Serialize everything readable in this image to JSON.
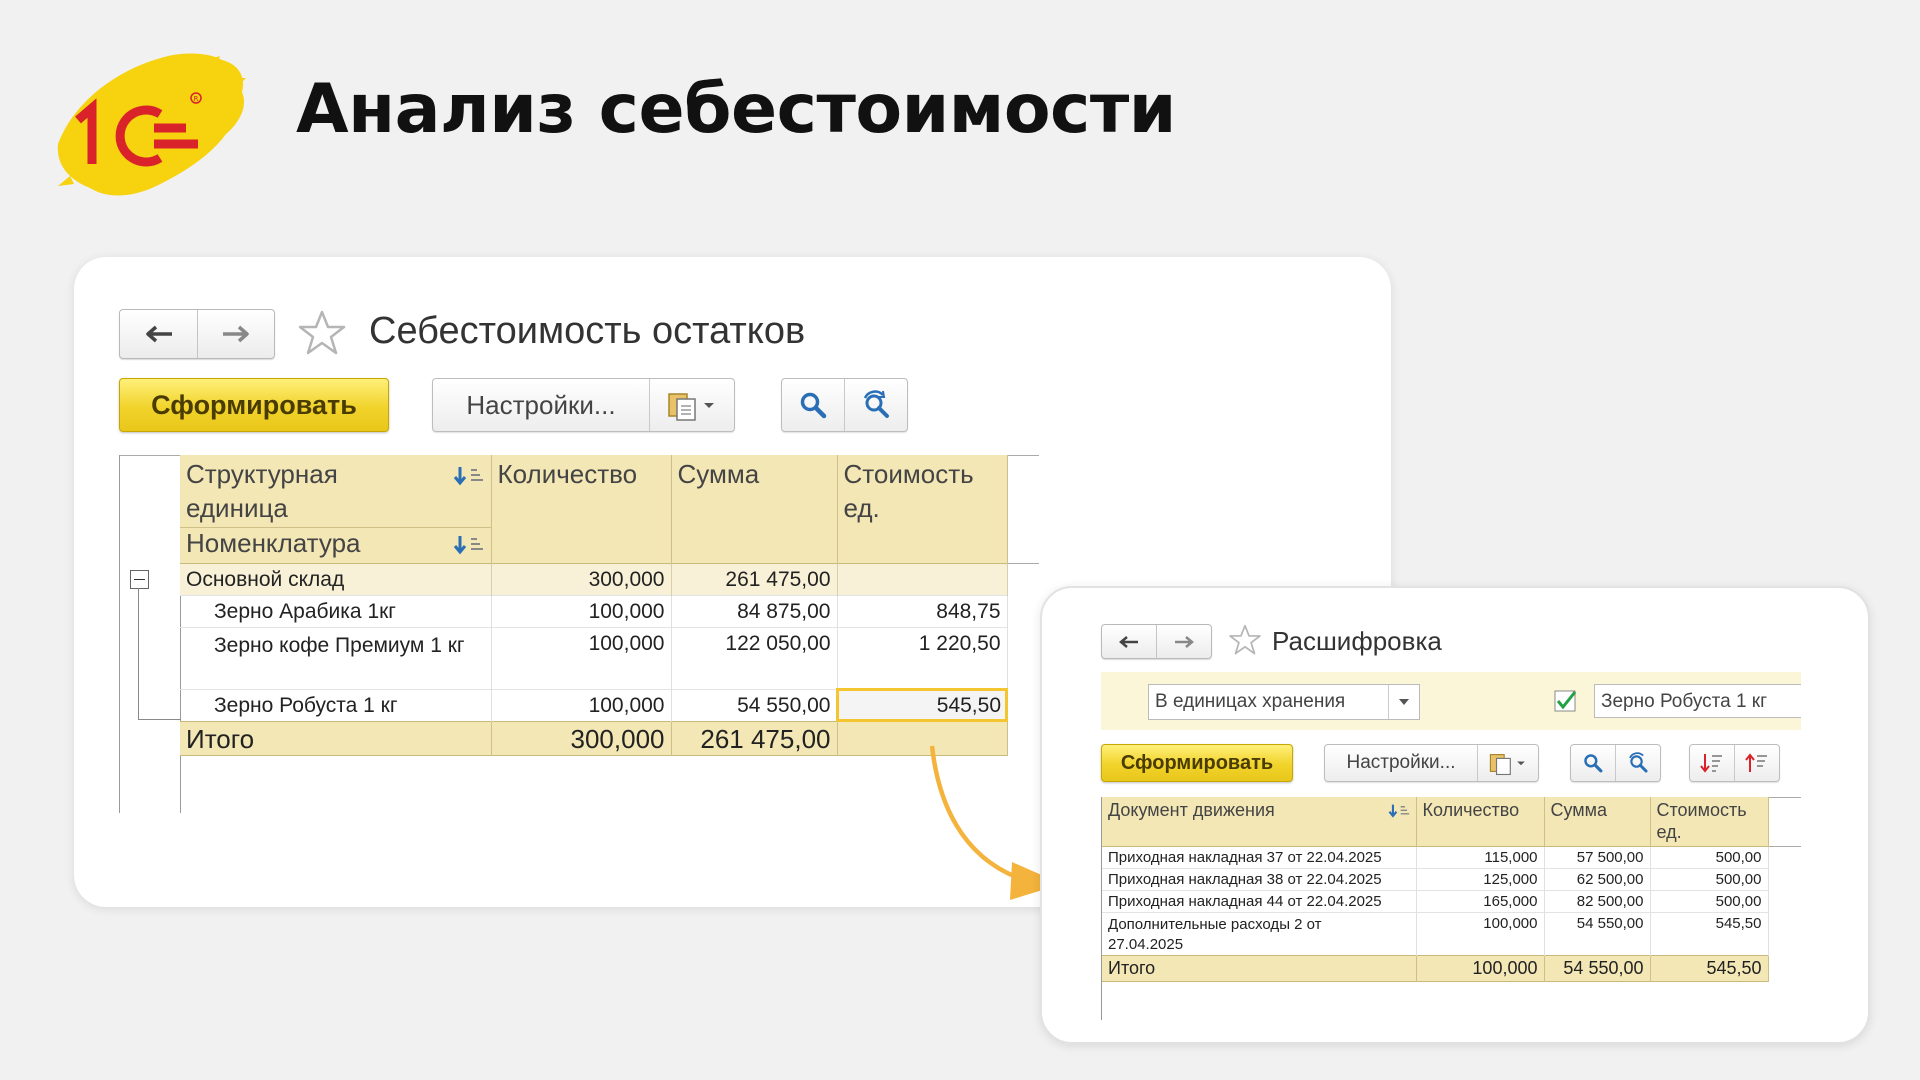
{
  "slide": {
    "title": "Анализ себестоимости",
    "logo_icon": "1c-logo"
  },
  "main_window": {
    "title": "Себестоимость остатков",
    "nav": {
      "back_icon": "arrow-left-icon",
      "forward_icon": "arrow-right-icon"
    },
    "favorite_icon": "star-icon",
    "toolbar": {
      "generate_label": "Сформировать",
      "settings_label": "Настройки...",
      "variant_icon": "report-variant-icon",
      "search_icon": "search-icon",
      "refresh_search_icon": "search-reset-icon"
    },
    "table": {
      "headers": {
        "structural_unit": "Структурная единица",
        "nomenclature": "Номенклатура",
        "quantity": "Количество",
        "sum": "Сумма",
        "unit_cost": "Стоимость ед."
      },
      "group": {
        "name": "Основной склад",
        "quantity": "300,000",
        "sum": "261 475,00",
        "unit_cost": ""
      },
      "rows": [
        {
          "name": "Зерно Арабика 1кг",
          "quantity": "100,000",
          "sum": "84 875,00",
          "unit_cost": "848,75"
        },
        {
          "name": "Зерно кофе Премиум 1 кг",
          "quantity": "100,000",
          "sum": "122 050,00",
          "unit_cost": "1 220,50"
        },
        {
          "name": "Зерно Робуста 1 кг",
          "quantity": "100,000",
          "sum": "54 550,00",
          "unit_cost": "545,50"
        }
      ],
      "total": {
        "label": "Итого",
        "quantity": "300,000",
        "sum": "261 475,00",
        "unit_cost": ""
      }
    }
  },
  "detail_window": {
    "title": "Расшифровка",
    "units_select_value": "В единицах хранения",
    "filter_checked": true,
    "filter_value": "Зерно Робуста 1 кг",
    "toolbar": {
      "generate_label": "Сформировать",
      "settings_label": "Настройки..."
    },
    "table": {
      "headers": {
        "document": "Документ движения",
        "quantity": "Количество",
        "sum": "Сумма",
        "unit_cost": "Стоимость ед."
      },
      "rows": [
        {
          "document": "Приходная накладная 37 от 22.04.2025",
          "quantity": "115,000",
          "sum": "57 500,00",
          "unit_cost": "500,00"
        },
        {
          "document": "Приходная накладная 38 от 22.04.2025",
          "quantity": "125,000",
          "sum": "62 500,00",
          "unit_cost": "500,00"
        },
        {
          "document": "Приходная накладная 44 от 22.04.2025",
          "quantity": "165,000",
          "sum": "82 500,00",
          "unit_cost": "500,00"
        },
        {
          "document": "Дополнительные расходы 2 от 27.04.2025",
          "quantity": "100,000",
          "sum": "54 550,00",
          "unit_cost": "545,50"
        }
      ],
      "total": {
        "label": "Итого",
        "quantity": "100,000",
        "sum": "54 550,00",
        "unit_cost": "545,50"
      }
    }
  },
  "colors": {
    "accent_yellow": "#f1d32b",
    "header_bg": "#f3e7b6",
    "highlight": "#f2c531",
    "arrow": "#f3b33c",
    "logo_red": "#d9222a"
  }
}
